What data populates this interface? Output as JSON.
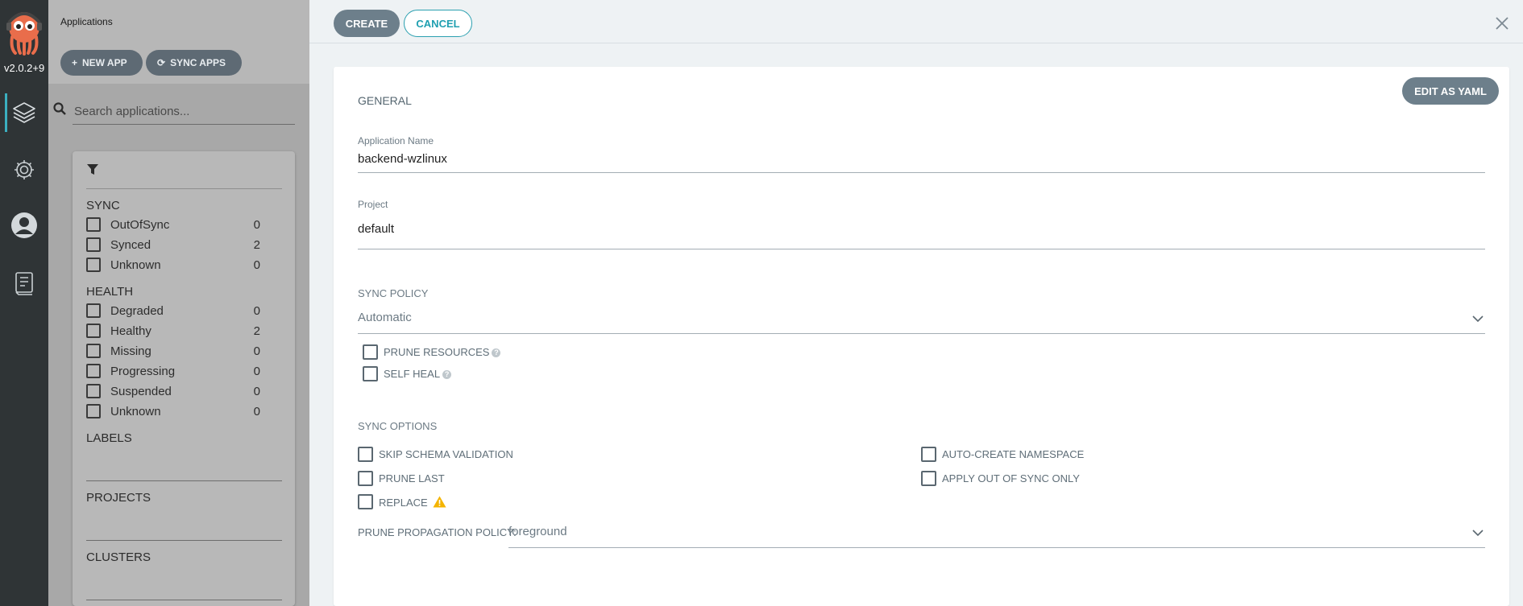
{
  "nav": {
    "version": "v2.0.2+9",
    "icons": [
      "argo-logo-icon",
      "layers-icon",
      "gear-icon",
      "user-icon",
      "docs-icon"
    ]
  },
  "apps": {
    "title": "Applications",
    "new_app": "NEW APP",
    "sync_apps": "SYNC APPS",
    "search_placeholder": "Search applications...",
    "filters": {
      "sync_heading": "SYNC",
      "sync": [
        {
          "label": "OutOfSync",
          "count": "0"
        },
        {
          "label": "Synced",
          "count": "2"
        },
        {
          "label": "Unknown",
          "count": "0"
        }
      ],
      "health_heading": "HEALTH",
      "health": [
        {
          "label": "Degraded",
          "count": "0"
        },
        {
          "label": "Healthy",
          "count": "2"
        },
        {
          "label": "Missing",
          "count": "0"
        },
        {
          "label": "Progressing",
          "count": "0"
        },
        {
          "label": "Suspended",
          "count": "0"
        },
        {
          "label": "Unknown",
          "count": "0"
        }
      ],
      "labels_heading": "LABELS",
      "projects_heading": "PROJECTS",
      "clusters_heading": "CLUSTERS"
    }
  },
  "toolbar": {
    "create": "CREATE",
    "cancel": "CANCEL"
  },
  "form": {
    "edit_yaml": "EDIT AS YAML",
    "general": "GENERAL",
    "app_name_label": "Application Name",
    "app_name_value": "backend-wzlinux",
    "project_label": "Project",
    "project_value": "default",
    "sync_policy_heading": "SYNC POLICY",
    "sync_policy_value": "Automatic",
    "prune_resources": "PRUNE RESOURCES",
    "self_heal": "SELF HEAL",
    "sync_options_heading": "SYNC OPTIONS",
    "skip_schema": "SKIP SCHEMA VALIDATION",
    "prune_last": "PRUNE LAST",
    "replace": "REPLACE",
    "auto_create_ns": "AUTO-CREATE NAMESPACE",
    "apply_out_of_sync": "APPLY OUT OF SYNC ONLY",
    "prune_propagation_label": "PRUNE PROPAGATION POLICY:",
    "prune_propagation_value": "foreground"
  },
  "colors": {
    "accent": "#3bafc0",
    "button_dark": "#6d7f8b",
    "warning": "#f4b400"
  }
}
